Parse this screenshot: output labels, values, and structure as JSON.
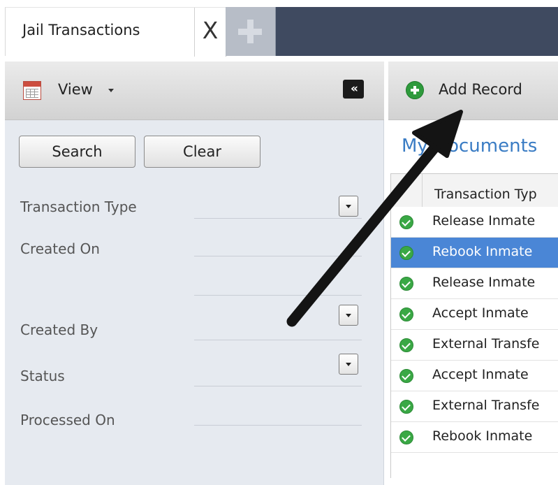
{
  "tabs": {
    "active_tab_label": "Jail Transactions",
    "close_glyph": "X",
    "add_tab_icon": "plus-icon"
  },
  "filter_panel": {
    "view_menu_label": "View",
    "view_icon": "calendar-icon",
    "collapse_glyph": "«",
    "search_button": "Search",
    "clear_button": "Clear",
    "fields": {
      "transaction_type": "Transaction Type",
      "created_on": "Created On",
      "created_by": "Created By",
      "status": "Status",
      "processed_on": "Processed On"
    }
  },
  "records_panel": {
    "add_record_label": "Add Record",
    "add_icon": "add-circle-icon",
    "documents_title": "My Documents",
    "column_header": "Transaction Typ",
    "rows": [
      {
        "label": "Release Inmate",
        "selected": false
      },
      {
        "label": "Rebook Inmate",
        "selected": true
      },
      {
        "label": "Release Inmate",
        "selected": false
      },
      {
        "label": "Accept Inmate",
        "selected": false
      },
      {
        "label": "External Transfe",
        "selected": false
      },
      {
        "label": "Accept Inmate",
        "selected": false
      },
      {
        "label": "External Transfe",
        "selected": false
      },
      {
        "label": "Rebook Inmate",
        "selected": false
      }
    ]
  },
  "colors": {
    "tabbar_dark": "#3f4a60",
    "panel_background": "#e6eaf0",
    "link_blue": "#3a7cc4",
    "selection_blue": "#4a86d6",
    "check_green": "#3aa845"
  }
}
